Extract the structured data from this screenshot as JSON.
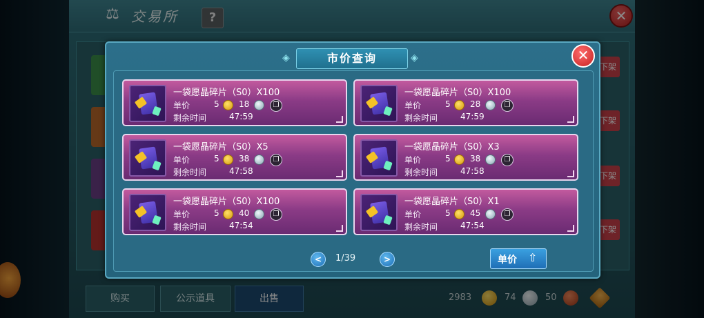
{
  "background": {
    "title": "交易所",
    "help_label": "?",
    "close_label": "✕",
    "unlist_label": "下架",
    "tabs": [
      "购买",
      "公示道具",
      "出售"
    ],
    "currency": {
      "gold": "2983",
      "silver": "74",
      "bronze": "50"
    }
  },
  "dialog": {
    "title": "市价查询",
    "close_label": "✕",
    "listings": [
      {
        "name": "一袋愿晶碎片（S0）X100",
        "price_label": "单价",
        "price_gold": "5",
        "price_silver": "18",
        "time_label": "剩余时间",
        "time": "47:59"
      },
      {
        "name": "一袋愿晶碎片（S0）X100",
        "price_label": "单价",
        "price_gold": "5",
        "price_silver": "28",
        "time_label": "剩余时间",
        "time": "47:59"
      },
      {
        "name": "一袋愿晶碎片（S0）X5",
        "price_label": "单价",
        "price_gold": "5",
        "price_silver": "38",
        "time_label": "剩余时间",
        "time": "47:58"
      },
      {
        "name": "一袋愿晶碎片（S0）X3",
        "price_label": "单价",
        "price_gold": "5",
        "price_silver": "38",
        "time_label": "剩余时间",
        "time": "47:58"
      },
      {
        "name": "一袋愿晶碎片（S0）X100",
        "price_label": "单价",
        "price_gold": "5",
        "price_silver": "40",
        "time_label": "剩余时间",
        "time": "47:54"
      },
      {
        "name": "一袋愿晶碎片（S0）X1",
        "price_label": "单价",
        "price_gold": "5",
        "price_silver": "45",
        "time_label": "剩余时间",
        "time": "47:54"
      }
    ],
    "pagination": {
      "prev_label": "<",
      "next_label": ">",
      "text": "1/39"
    },
    "sort": {
      "label": "单价",
      "icon": "arrow-up-icon"
    }
  },
  "colors": {
    "card_top": "#c25a9e",
    "card_bottom": "#6a2b72",
    "dialog_bg": "#2c6f8a",
    "accent_red": "#c52222"
  }
}
